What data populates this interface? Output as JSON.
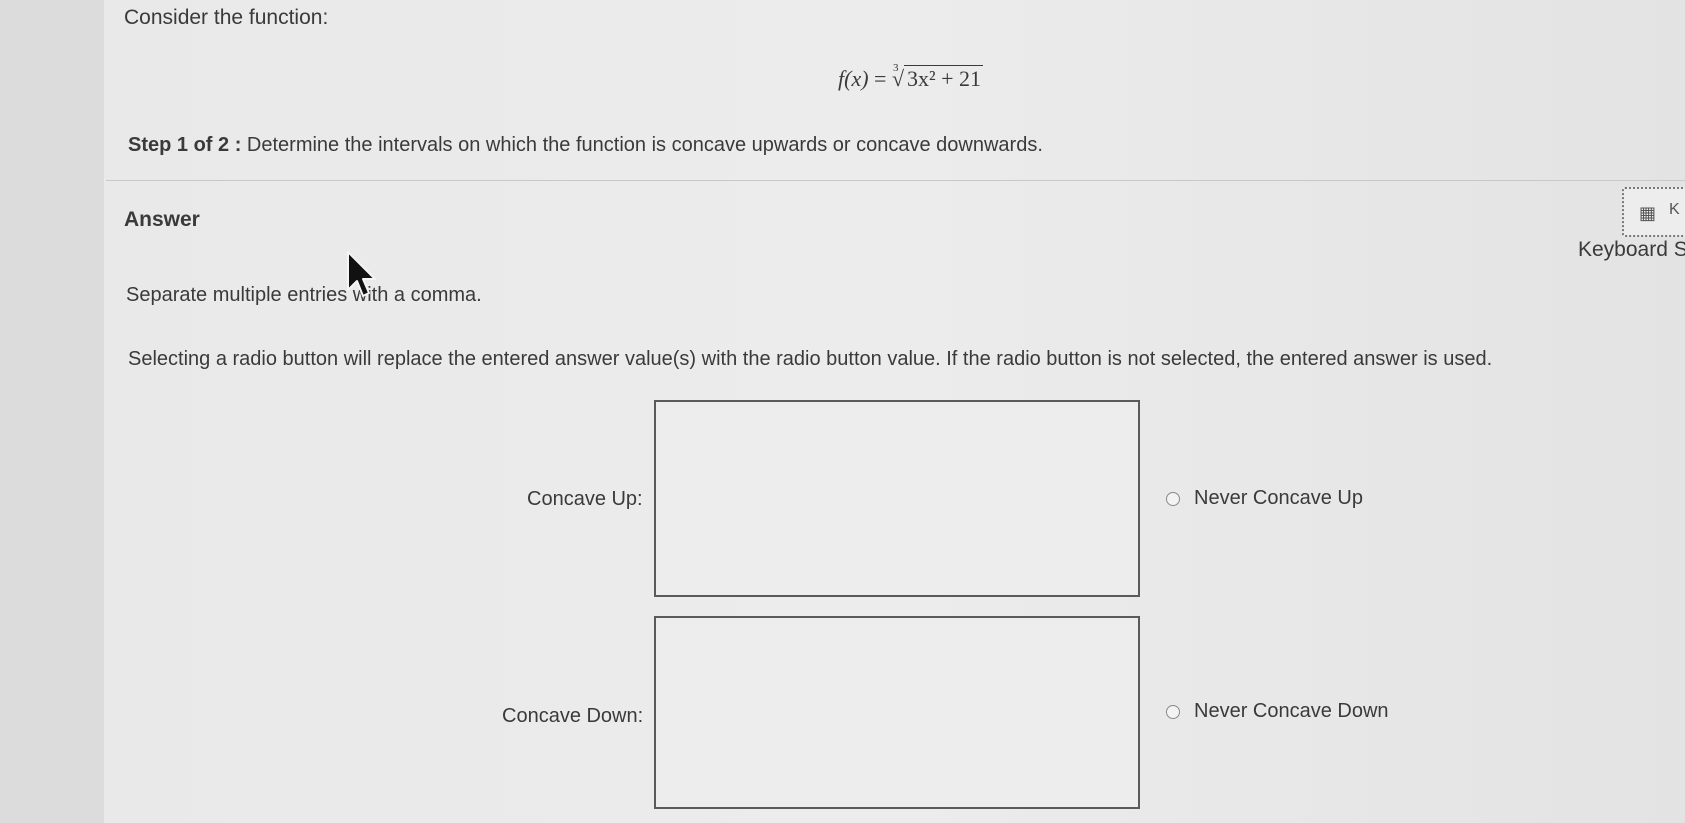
{
  "question": {
    "intro": "Consider the function:",
    "formula": {
      "lhs": "f(x)",
      "equals": "=",
      "root_index": "3",
      "radicand": "3x² + 21"
    },
    "step_title": "Step 1 of 2 :",
    "step_text": " Determine the intervals on which the function is concave upwards or concave downwards."
  },
  "answer": {
    "heading": "Answer",
    "keyboard_icon": "calculator-keyboard-icon",
    "keyboard_letter": "K",
    "keyboard_label": "Keyboard S",
    "hint": "Separate multiple entries with a comma.",
    "radio_note": "Selecting a radio button will replace the entered answer value(s) with the radio button value. If the radio button is not selected, the entered answer is used.",
    "concave_up": {
      "label": "Concave Up:",
      "value": "",
      "radio_label": "Never Concave Up",
      "radio_selected": false
    },
    "concave_down": {
      "label": "Concave Down:",
      "value": "",
      "radio_label": "Never Concave Down",
      "radio_selected": false
    }
  },
  "colors": {
    "background": "#e9e9e9",
    "text": "#3a3a3a",
    "input_border": "#5a5a5a"
  }
}
